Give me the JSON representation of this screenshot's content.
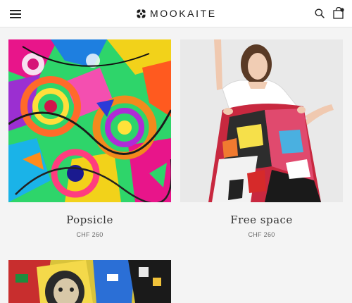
{
  "header": {
    "brand": "MOOKAITE",
    "menu_icon": "hamburger-menu-icon",
    "search_icon": "search-icon",
    "cart_icon": "shopping-bag-icon"
  },
  "products": [
    {
      "title": "Popsicle",
      "price": "CHF 260"
    },
    {
      "title": "Free space",
      "price": "CHF 260"
    }
  ],
  "colors": {
    "header_bg": "#ffffff",
    "page_bg": "#f4f4f4",
    "text": "#222222"
  }
}
